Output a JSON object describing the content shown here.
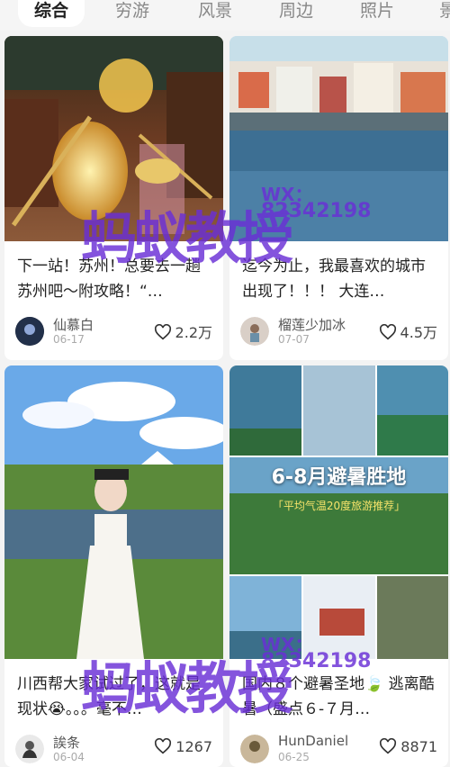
{
  "tabs": [
    "综合",
    "穷游",
    "风景",
    "周边",
    "照片",
    "景"
  ],
  "cards": [
    {
      "title": "下一站！苏州！总要去一趟苏州吧～附攻略！“…",
      "author": "仙慕白",
      "date": "06-17",
      "likes": "2.2万"
    },
    {
      "title": "迄今为止，我最喜欢的城市出现了！！！ 大连…",
      "author": "榴莲少加冰",
      "date": "07-07",
      "likes": "4.5万"
    },
    {
      "title": "川西帮大家试过了，这就是现状😭。。。毫不…",
      "author": "誒条",
      "date": "06-04",
      "likes": "1267"
    },
    {
      "title": "国内８个避暑圣地🍃 逃离酷暑（盛点６-７月…",
      "author": "HunDaniel",
      "date": "06-25",
      "likes": "8871"
    }
  ],
  "poster": {
    "headline": "6-8月避暑胜地",
    "subhead": "「平均气温20度旅游推荐」"
  },
  "watermark": {
    "wx": "WX：",
    "number": "82342198",
    "brand": "蚂蚁教授"
  },
  "colors": {
    "accent": "#6a2fd6",
    "heart": "#333333"
  },
  "icons": {
    "like": "heart-outline-icon"
  }
}
